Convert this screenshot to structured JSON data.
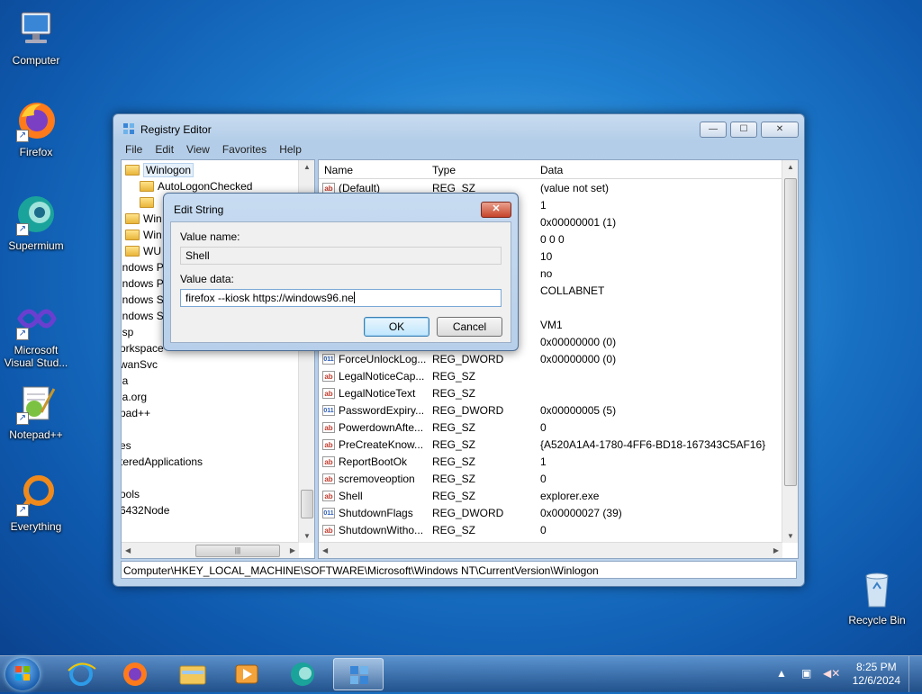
{
  "desktop": {
    "icons": [
      {
        "label": "Computer",
        "icon": "computer-icon"
      },
      {
        "label": "Firefox",
        "icon": "firefox-icon"
      },
      {
        "label": "Supermium",
        "icon": "supermium-icon"
      },
      {
        "label": "Microsoft Visual Stud...",
        "icon": "visual-studio-icon"
      },
      {
        "label": "Notepad++",
        "icon": "notepadpp-icon"
      },
      {
        "label": "Everything",
        "icon": "everything-icon"
      },
      {
        "label": "Recycle Bin",
        "icon": "recycle-bin-icon"
      }
    ]
  },
  "window": {
    "title": "Registry Editor",
    "controls": {
      "minimize": "—",
      "maximize": "☐",
      "close": "✕"
    },
    "menu": [
      "File",
      "Edit",
      "View",
      "Favorites",
      "Help"
    ],
    "tree": [
      {
        "label": "Winlogon",
        "folder": true
      },
      {
        "label": "AutoLogonChecked",
        "folder": true
      },
      {
        "label": "",
        "folder": true
      },
      {
        "label": "Win",
        "folder": true
      },
      {
        "label": "Win",
        "folder": true
      },
      {
        "label": "WU",
        "folder": true
      },
      {
        "label": "indows P",
        "folder": false
      },
      {
        "label": "indows P",
        "folder": false
      },
      {
        "label": "indows S",
        "folder": false
      },
      {
        "label": "indows S",
        "folder": false
      },
      {
        "label": "isp",
        "folder": false
      },
      {
        "label": "orkspace",
        "folder": false
      },
      {
        "label": "wanSvc",
        "folder": false
      },
      {
        "label": "la",
        "folder": false
      },
      {
        "label": "la.org",
        "folder": false
      },
      {
        "label": "pad++",
        "folder": false
      },
      {
        "label": "",
        "folder": false
      },
      {
        "label": "es",
        "folder": false
      },
      {
        "label": "teredApplications",
        "folder": false
      },
      {
        "label": "",
        "folder": false
      },
      {
        "label": "ools",
        "folder": false
      },
      {
        "label": "6432Node",
        "folder": false
      }
    ],
    "columns": {
      "name": "Name",
      "type": "Type",
      "data": "Data"
    },
    "values": [
      {
        "name": "(Default)",
        "type": "REG_SZ",
        "data": "(value not set)",
        "kind": "sz"
      },
      {
        "name": "",
        "type": "",
        "data": "1",
        "kind": "none"
      },
      {
        "name": "",
        "type": "",
        "data": "0x00000001 (1)",
        "kind": "none"
      },
      {
        "name": "",
        "type": "",
        "data": "0 0 0",
        "kind": "none"
      },
      {
        "name": "",
        "type": "",
        "data": "10",
        "kind": "none"
      },
      {
        "name": "",
        "type": "",
        "data": "no",
        "kind": "none"
      },
      {
        "name": "",
        "type": "",
        "data": "COLLABNET",
        "kind": "none"
      },
      {
        "name": "",
        "type": "",
        "data": "",
        "kind": "none"
      },
      {
        "name": "",
        "type": "",
        "data": "VM1",
        "kind": "none"
      },
      {
        "name": "",
        "type": "",
        "data": "0x00000000 (0)",
        "kind": "none"
      },
      {
        "name": "ForceUnlockLog...",
        "type": "REG_DWORD",
        "data": "0x00000000 (0)",
        "kind": "bin"
      },
      {
        "name": "LegalNoticeCap...",
        "type": "REG_SZ",
        "data": "",
        "kind": "sz"
      },
      {
        "name": "LegalNoticeText",
        "type": "REG_SZ",
        "data": "",
        "kind": "sz"
      },
      {
        "name": "PasswordExpiry...",
        "type": "REG_DWORD",
        "data": "0x00000005 (5)",
        "kind": "bin"
      },
      {
        "name": "PowerdownAfte...",
        "type": "REG_SZ",
        "data": "0",
        "kind": "sz"
      },
      {
        "name": "PreCreateKnow...",
        "type": "REG_SZ",
        "data": "{A520A1A4-1780-4FF6-BD18-167343C5AF16}",
        "kind": "sz"
      },
      {
        "name": "ReportBootOk",
        "type": "REG_SZ",
        "data": "1",
        "kind": "sz"
      },
      {
        "name": "scremoveoption",
        "type": "REG_SZ",
        "data": "0",
        "kind": "sz"
      },
      {
        "name": "Shell",
        "type": "REG_SZ",
        "data": "explorer.exe",
        "kind": "sz"
      },
      {
        "name": "ShutdownFlags",
        "type": "REG_DWORD",
        "data": "0x00000027 (39)",
        "kind": "bin"
      },
      {
        "name": "ShutdownWitho...",
        "type": "REG_SZ",
        "data": "0",
        "kind": "sz"
      }
    ],
    "status_path": "Computer\\HKEY_LOCAL_MACHINE\\SOFTWARE\\Microsoft\\Windows NT\\CurrentVersion\\Winlogon"
  },
  "dialog": {
    "title": "Edit String",
    "close": "✕",
    "value_name_label": "Value name:",
    "value_name": "Shell",
    "value_data_label": "Value data:",
    "value_data": "firefox --kiosk https://windows96.ne",
    "ok": "OK",
    "cancel": "Cancel"
  },
  "taskbar": {
    "time": "8:25 PM",
    "date": "12/6/2024",
    "apps": [
      "internet-explorer-icon",
      "firefox-icon",
      "file-explorer-icon",
      "media-player-icon",
      "supermium-icon",
      "registry-editor-icon"
    ]
  },
  "colors": {
    "accent": "#3c7fb1",
    "desktop": "#1f7fd0",
    "close_red": "#c6432a"
  }
}
